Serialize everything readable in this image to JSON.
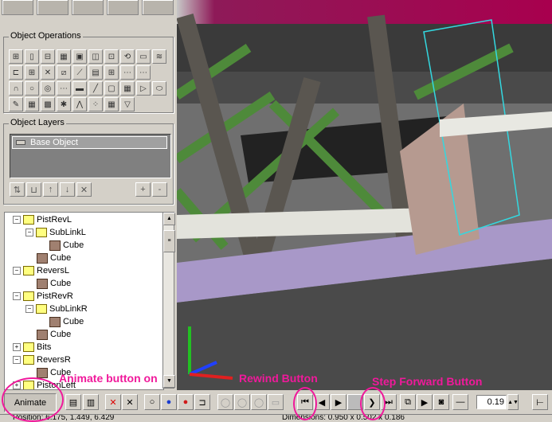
{
  "object_operations": {
    "title": "Object Operations"
  },
  "object_layers": {
    "title": "Object Layers",
    "items": [
      {
        "label": "Base Object"
      }
    ],
    "add_label": "+",
    "remove_label": "-"
  },
  "tree": {
    "items": [
      {
        "label": "PistRevL",
        "level": 1,
        "kind": "folder",
        "expander": "−"
      },
      {
        "label": "SubLinkL",
        "level": 2,
        "kind": "folder",
        "expander": "−"
      },
      {
        "label": "Cube",
        "level": 3,
        "kind": "cube"
      },
      {
        "label": "Cube",
        "level": 2,
        "kind": "cube"
      },
      {
        "label": "ReversL",
        "level": 1,
        "kind": "folder",
        "expander": "−"
      },
      {
        "label": "Cube",
        "level": 2,
        "kind": "cube"
      },
      {
        "label": "PistRevR",
        "level": 1,
        "kind": "folder",
        "expander": "−"
      },
      {
        "label": "SubLinkR",
        "level": 2,
        "kind": "folder",
        "expander": "−"
      },
      {
        "label": "Cube",
        "level": 3,
        "kind": "cube"
      },
      {
        "label": "Cube",
        "level": 2,
        "kind": "cube"
      },
      {
        "label": "Bits",
        "level": 1,
        "kind": "folder",
        "expander": "+"
      },
      {
        "label": "ReversR",
        "level": 1,
        "kind": "folder",
        "expander": "−"
      },
      {
        "label": "Cube",
        "level": 2,
        "kind": "cube"
      },
      {
        "label": "PistonLeft",
        "level": 1,
        "kind": "folder",
        "expander": "+"
      }
    ]
  },
  "bottombar": {
    "animate_label": "Animate",
    "frame_value": "0.19"
  },
  "status": {
    "position": "Position: 6.175, 1.449, 6.429",
    "dimensions": "Dimensions: 0.950 x 0.502 x 0.186"
  },
  "annotations": {
    "animate": "Animate button on",
    "rewind": "Rewind Button",
    "step_forward": "Step Forward Button"
  },
  "colors": {
    "annotation": "#f0199b",
    "panel": "#d4d0c8",
    "viewport_sky": "#a8004e",
    "beam_purple": "#a898c8",
    "lattice_green": "#4e8a3a"
  }
}
